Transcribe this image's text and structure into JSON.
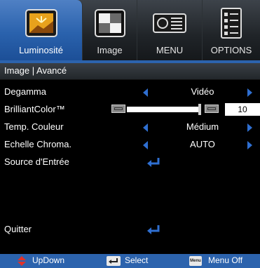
{
  "tabs": [
    {
      "label": "Luminosité",
      "icon": "picture-sun-icon",
      "active": true
    },
    {
      "label": "Image",
      "icon": "contrast-squares-icon",
      "active": false
    },
    {
      "label": "MENU",
      "icon": "projector-icon",
      "active": false
    },
    {
      "label": "OPTIONS",
      "icon": "checklist-icon",
      "active": false
    }
  ],
  "header": {
    "title": "Image | Avancé"
  },
  "rows": [
    {
      "label": "Degamma",
      "value": "Vidéo"
    },
    {
      "label": "BrilliantColor™",
      "value": "10",
      "slider_fraction": 1.0
    },
    {
      "label": "Temp. Couleur",
      "value": "Médium"
    },
    {
      "label": "Echelle Chroma.",
      "value": "AUTO"
    },
    {
      "label": "Source d'Entrée",
      "value": ""
    },
    {
      "label": "Quitter",
      "value": ""
    }
  ],
  "footer": {
    "updown": "UpDown",
    "select": "Select",
    "menu_icon_text": "Menu",
    "menu_off": "Menu Off"
  },
  "colors": {
    "accent_blue": "#2c63ad",
    "arrow_blue": "#2f6fd1",
    "background": "#000000"
  }
}
